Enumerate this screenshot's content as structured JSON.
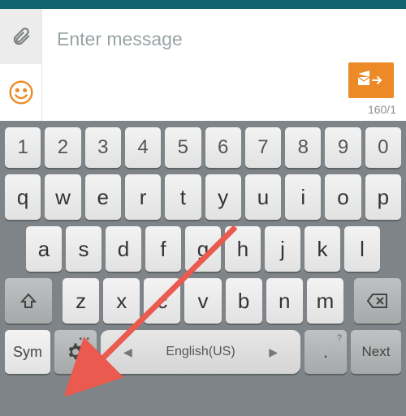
{
  "compose": {
    "placeholder": "Enter message",
    "char_count": "160/1"
  },
  "keyboard": {
    "row_nums": [
      "1",
      "2",
      "3",
      "4",
      "5",
      "6",
      "7",
      "8",
      "9",
      "0"
    ],
    "row_q": [
      "q",
      "w",
      "e",
      "r",
      "t",
      "y",
      "u",
      "i",
      "o",
      "p"
    ],
    "row_a": [
      "a",
      "s",
      "d",
      "f",
      "g",
      "h",
      "j",
      "k",
      "l"
    ],
    "row_z": [
      "z",
      "x",
      "c",
      "v",
      "b",
      "n",
      "m"
    ],
    "sym_label": "Sym",
    "space_label": "English(US)",
    "punct_label": ".",
    "punct_super": "?",
    "next_label": "Next"
  }
}
